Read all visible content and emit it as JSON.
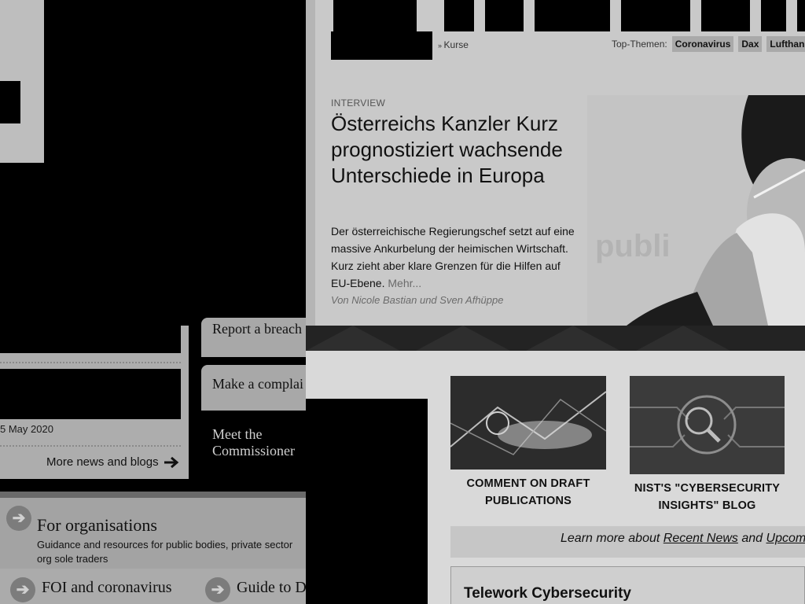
{
  "left_window": {
    "news_date": "5 May 2020",
    "more_news_label": "More news and blogs",
    "report_breach_label": "Report a breach",
    "make_complaint_label": "Make a complai",
    "meet_commissioner_line1": "Meet the",
    "meet_commissioner_line2": "Commissioner",
    "for_orgs_title": "For organisations",
    "for_orgs_desc": "Guidance and resources for public bodies, private sector org sole traders",
    "foi_label": "FOI and coronavirus",
    "guide_label": "Guide to D"
  },
  "handelsblatt": {
    "kurse_label": "Kurse",
    "top_topics_label": "Top-Themen:",
    "topics": [
      "Coronavirus",
      "Dax",
      "Lufthansa"
    ],
    "article": {
      "tag": "INTERVIEW",
      "title": "Österreichs Kanzler Kurz prognostiziert wachsende Unterschiede in Europa",
      "teaser": "Der österreichische Regierungschef setzt auf eine massive Ankurbelung der heimischen Wirtschaft. Kurz zieht aber klare Grenzen für die Hilfen auf EU-Ebene.",
      "more": "Mehr...",
      "author": "Von Nicole Bastian und Sven Afhüppe"
    }
  },
  "nist": {
    "card1_line1": "COMMENT ON DRAFT",
    "card1_line2": "PUBLICATIONS",
    "card2_line1": "NIST'S \"CYBERSECURITY",
    "card2_line2": "INSIGHTS\" BLOG",
    "learn_more_prefix": "Learn more about",
    "recent_news_link": "Recent News",
    "and_text": "and",
    "upcoming_link": "Upcomin",
    "telework_title": "Telework Cybersecurity"
  }
}
